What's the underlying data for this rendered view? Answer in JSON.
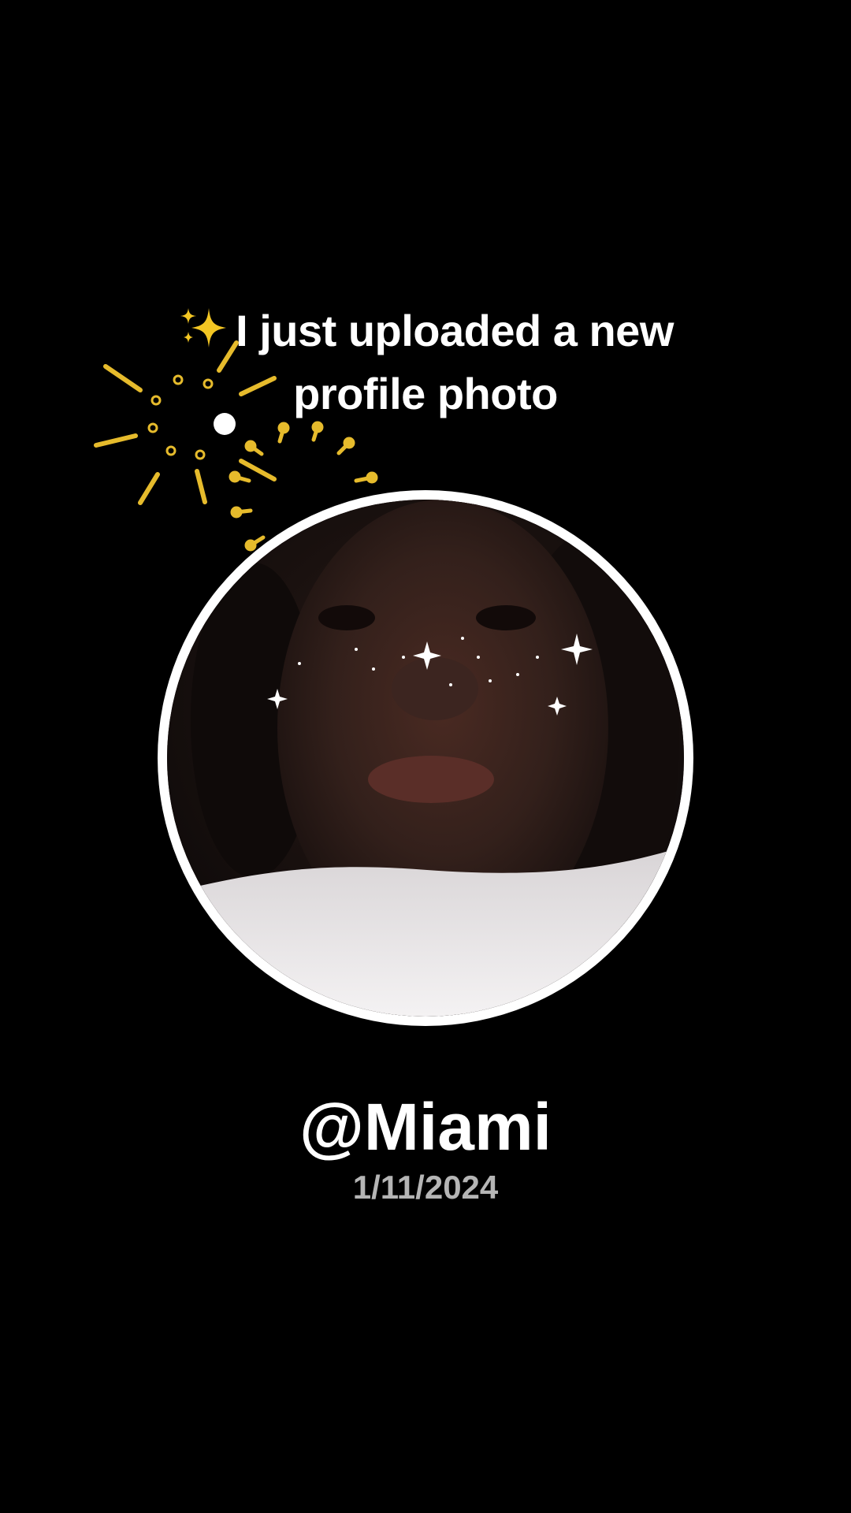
{
  "post": {
    "headline_line1": "I just uploaded a new",
    "headline_line2": "profile photo",
    "username": "@Miami",
    "date": "1/11/2024"
  },
  "icons": {
    "headline_emoji": "sparkles-icon",
    "decoration": "fireworks-burst-icon",
    "profile_image": "profile-photo"
  },
  "colors": {
    "background": "#000000",
    "text_primary": "#ffffff",
    "text_secondary": "#b5b5b5",
    "frame": "#ffffff",
    "sparkle_gold": "#f3c623",
    "firework_gold": "#e6bb2c"
  }
}
